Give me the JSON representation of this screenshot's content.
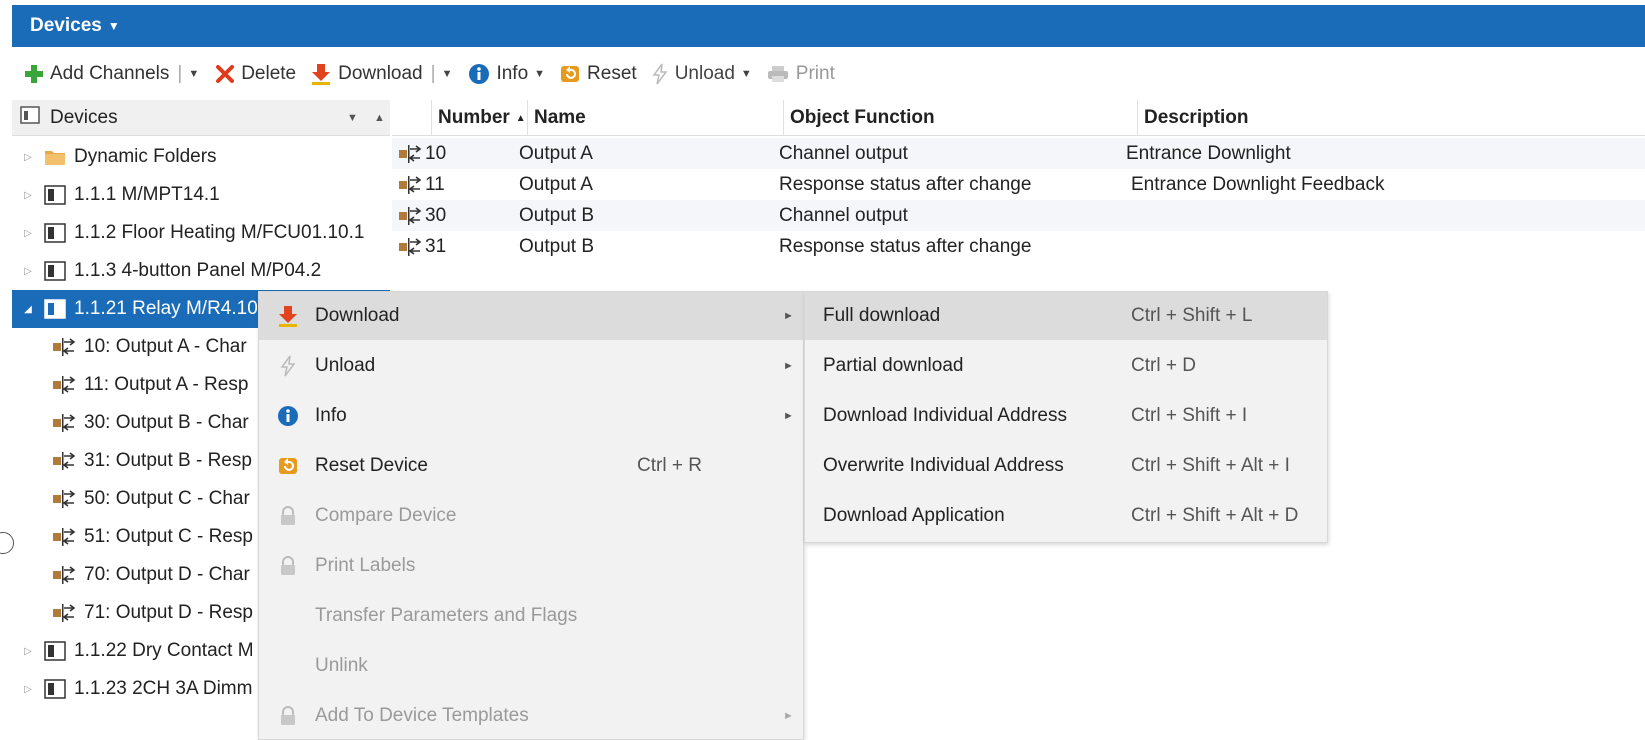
{
  "title": "Devices",
  "toolbar": {
    "add_channels": "Add Channels",
    "delete": "Delete",
    "download": "Download",
    "info": "Info",
    "reset": "Reset",
    "unload": "Unload",
    "print": "Print"
  },
  "tree": {
    "header": "Devices",
    "items": [
      {
        "label": "Dynamic Folders"
      },
      {
        "label": "1.1.1 M/MPT14.1"
      },
      {
        "label": "1.1.2 Floor Heating M/FCU01.10.1"
      },
      {
        "label": "1.1.3 4-button Panel M/P04.2"
      },
      {
        "label": "1.1.21 Relay M/R4.10"
      },
      {
        "label": "10: Output A - Char"
      },
      {
        "label": "11: Output A - Resp"
      },
      {
        "label": "30: Output B - Char"
      },
      {
        "label": "31: Output B - Resp"
      },
      {
        "label": "50: Output C - Char"
      },
      {
        "label": "51: Output C - Resp"
      },
      {
        "label": "70: Output D - Char"
      },
      {
        "label": "71: Output D - Resp"
      },
      {
        "label": "1.1.22 Dry Contact M"
      },
      {
        "label": "1.1.23 2CH 3A Dimm"
      }
    ]
  },
  "grid": {
    "columns": [
      "Number",
      "Name",
      "Object Function",
      "Description"
    ],
    "rows": [
      {
        "number": "10",
        "name": "Output A",
        "function": "Channel output",
        "description": "Entrance Downlight"
      },
      {
        "number": "11",
        "name": "Output A",
        "function": "Response status after change",
        "description": "Entrance Downlight Feedback"
      },
      {
        "number": "30",
        "name": "Output B",
        "function": "Channel output",
        "description": ""
      },
      {
        "number": "31",
        "name": "Output B",
        "function": "Response status after change",
        "description": ""
      }
    ]
  },
  "context_menu": {
    "items": [
      {
        "label": "Download",
        "shortcut": ""
      },
      {
        "label": "Unload",
        "shortcut": ""
      },
      {
        "label": "Info",
        "shortcut": ""
      },
      {
        "label": "Reset Device",
        "shortcut": "Ctrl + R"
      },
      {
        "label": "Compare Device",
        "shortcut": ""
      },
      {
        "label": "Print Labels",
        "shortcut": ""
      },
      {
        "label": "Transfer Parameters and Flags",
        "shortcut": ""
      },
      {
        "label": "Unlink",
        "shortcut": ""
      },
      {
        "label": "Add To Device Templates",
        "shortcut": ""
      }
    ]
  },
  "submenu": {
    "items": [
      {
        "label": "Full download",
        "shortcut": "Ctrl + Shift + L"
      },
      {
        "label": "Partial download",
        "shortcut": "Ctrl + D"
      },
      {
        "label": "Download Individual Address",
        "shortcut": "Ctrl + Shift + I"
      },
      {
        "label": "Overwrite Individual Address",
        "shortcut": "Ctrl + Shift + Alt + I"
      },
      {
        "label": "Download Application",
        "shortcut": "Ctrl + Shift + Alt + D"
      }
    ]
  },
  "colors": {
    "title_bar": "#1a6bb8",
    "selection": "#1a6bb8",
    "menu_bg": "#f2f2f2",
    "menu_hover": "#dcdcdc"
  }
}
